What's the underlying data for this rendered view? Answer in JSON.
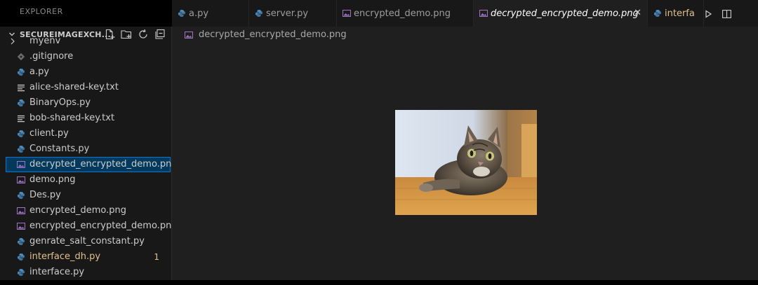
{
  "explorer_title": "EXPLORER",
  "folder_name": "SECUREIMAGEXCH...",
  "folder_chevron": "chevron-down-icon",
  "tabs": [
    {
      "label": "a.py",
      "icon": "python-icon"
    },
    {
      "label": "server.py",
      "icon": "python-icon"
    },
    {
      "label": "encrypted_demo.png",
      "icon": "image-icon"
    },
    {
      "label": "decrypted_encrypted_demo.png",
      "icon": "image-icon",
      "active": true
    },
    {
      "label": "interfa",
      "icon": "python-icon"
    }
  ],
  "tab_close_glyph": "✕",
  "breadcrumb": {
    "file": "decrypted_encrypted_demo.png"
  },
  "files": [
    {
      "name": "myenv",
      "icon": "folder-icon"
    },
    {
      "name": ".gitignore",
      "icon": "gitignore-icon"
    },
    {
      "name": "a.py",
      "icon": "python-icon"
    },
    {
      "name": "alice-shared-key.txt",
      "icon": "text-file-icon"
    },
    {
      "name": "BinaryOps.py",
      "icon": "python-icon"
    },
    {
      "name": "bob-shared-key.txt",
      "icon": "text-file-icon"
    },
    {
      "name": "client.py",
      "icon": "python-icon"
    },
    {
      "name": "Constants.py",
      "icon": "python-icon"
    },
    {
      "name": "decrypted_encrypted_demo.png",
      "icon": "image-icon",
      "selected": true
    },
    {
      "name": "demo.png",
      "icon": "image-icon"
    },
    {
      "name": "Des.py",
      "icon": "python-icon"
    },
    {
      "name": "encrypted_demo.png",
      "icon": "image-icon"
    },
    {
      "name": "encrypted_encrypted_demo.png",
      "icon": "image-icon"
    },
    {
      "name": "genrate_salt_constant.py",
      "icon": "python-icon"
    },
    {
      "name": "interface_dh.py",
      "icon": "python-icon",
      "modified": true,
      "badge": "1"
    },
    {
      "name": "interface.py",
      "icon": "python-icon"
    }
  ],
  "colors": {
    "accent": "#0078d4",
    "selection": "#04395e",
    "modified": "#e2c08d",
    "python_icon": "#4b8bbe",
    "image_icon": "#a074c4"
  }
}
